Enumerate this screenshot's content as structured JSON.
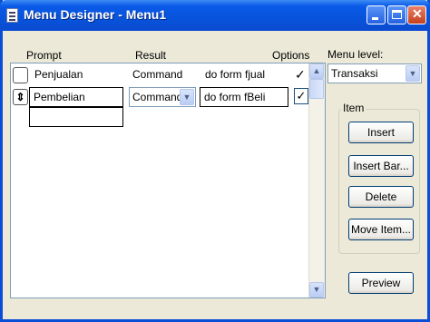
{
  "window": {
    "title": "Menu Designer - Menu1"
  },
  "columns": {
    "prompt": "Prompt",
    "result": "Result",
    "options": "Options"
  },
  "rows": [
    {
      "prompt": "Penjualan",
      "result": "Command",
      "command": "do form fjual",
      "options_checked": true
    },
    {
      "prompt": "Pembelian",
      "result": "Command",
      "command": "do form fBeli",
      "options_checked": true
    },
    {
      "prompt": "",
      "result": "",
      "command": "",
      "options_checked": false
    }
  ],
  "menu_level": {
    "label": "Menu level:",
    "value": "Transaksi"
  },
  "item_group": {
    "label": "Item",
    "insert": "Insert",
    "insert_bar": "Insert Bar...",
    "delete": "Delete",
    "move_item": "Move Item..."
  },
  "preview": "Preview",
  "icons": {
    "check": "✓",
    "down_arrow": "▼",
    "up_arrow": "▲",
    "move_arrows": "⇕"
  }
}
